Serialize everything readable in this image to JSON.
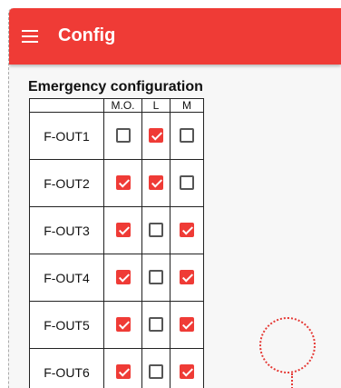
{
  "appbar": {
    "title": "Config",
    "menu_icon": "hamburger-menu-icon",
    "color": "#ef3b36"
  },
  "section": {
    "title": "Emergency configuration"
  },
  "table": {
    "headers": [
      "M.O.",
      "L",
      "M"
    ],
    "rows": [
      {
        "label": "F-OUT1",
        "mo": false,
        "l": true,
        "m": false
      },
      {
        "label": "F-OUT2",
        "mo": true,
        "l": true,
        "m": false
      },
      {
        "label": "F-OUT3",
        "mo": true,
        "l": false,
        "m": true
      },
      {
        "label": "F-OUT4",
        "mo": true,
        "l": false,
        "m": true
      },
      {
        "label": "F-OUT5",
        "mo": true,
        "l": false,
        "m": true
      },
      {
        "label": "F-OUT6",
        "mo": true,
        "l": false,
        "m": true
      }
    ]
  },
  "colors": {
    "accent": "#ef3b36",
    "checkbox_unchecked": "#555555"
  }
}
